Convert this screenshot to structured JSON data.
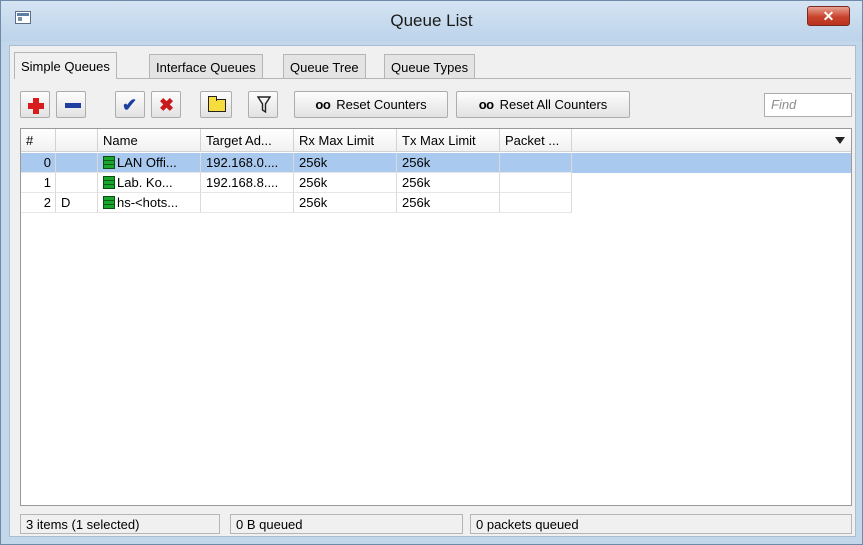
{
  "window": {
    "title": "Queue List",
    "close_label": "✕"
  },
  "tabs": [
    {
      "label": "Simple Queues",
      "active": true
    },
    {
      "label": "Interface Queues",
      "active": false
    },
    {
      "label": "Queue Tree",
      "active": false
    },
    {
      "label": "Queue Types",
      "active": false
    }
  ],
  "toolbar": {
    "reset_counters_icon": "oo",
    "reset_counters_label": "Reset Counters",
    "reset_all_counters_icon": "oo",
    "reset_all_counters_label": "Reset All Counters",
    "find_placeholder": "Find"
  },
  "table": {
    "columns": [
      "#",
      "",
      "Name",
      "Target Ad...",
      "Rx Max Limit",
      "Tx Max Limit",
      "Packet ..."
    ],
    "rows": [
      {
        "num": "0",
        "flag": "",
        "name": "LAN Offi...",
        "target": "192.168.0....",
        "rx": "256k",
        "tx": "256k",
        "packet": "",
        "selected": true
      },
      {
        "num": "1",
        "flag": "",
        "name": "Lab. Ko...",
        "target": "192.168.8....",
        "rx": "256k",
        "tx": "256k",
        "packet": "",
        "selected": false
      },
      {
        "num": "2",
        "flag": "D",
        "name": "hs-<hots...",
        "target": "",
        "rx": "256k",
        "tx": "256k",
        "packet": "",
        "selected": false
      }
    ]
  },
  "status": {
    "items": "3 items (1 selected)",
    "bytes": "0 B queued",
    "packets": "0 packets queued"
  },
  "colors": {
    "selection": "#a9c9ee",
    "titlebar": "#bcd3ea",
    "queue_icon": "#1aa52c"
  }
}
